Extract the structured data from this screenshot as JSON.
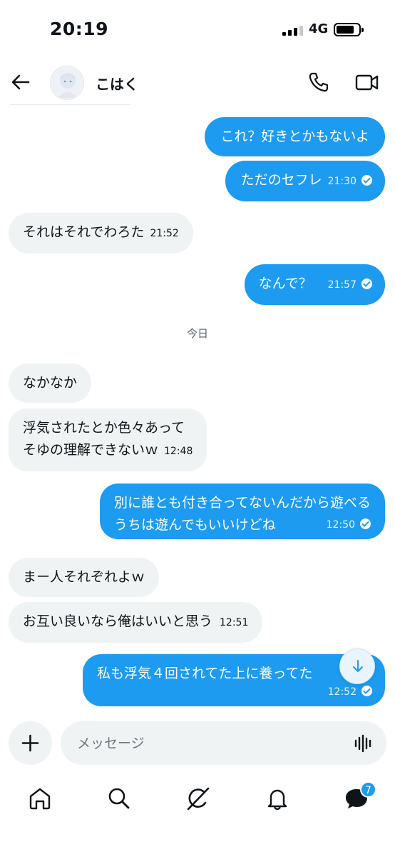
{
  "status_bar": {
    "time": "20:19",
    "network": "4G"
  },
  "header": {
    "contact_name": "こはく"
  },
  "date_separator": "今日",
  "messages": [
    {
      "dir": "out",
      "text": "これ？好きとかもないよ"
    },
    {
      "dir": "out",
      "text": "ただのセフレ",
      "time": "21:30",
      "read": true
    },
    {
      "dir": "in",
      "text": "それはそれでわろた",
      "time": "21:52"
    },
    {
      "dir": "out",
      "text": "なんで？",
      "time": "21:57",
      "read": true
    },
    {
      "dir": "in",
      "text": "なかなか"
    },
    {
      "dir": "in",
      "lines": [
        "浮気されたとか色々あって",
        "そゆの理解できないｗ"
      ],
      "time": "12:48"
    },
    {
      "dir": "out",
      "lines": [
        "別に誰とも付き合ってないんだから遊べる",
        "うちは遊んでもいいけどね"
      ],
      "time": "12:50",
      "read": true
    },
    {
      "dir": "in",
      "text": "まー人それぞれよｗ"
    },
    {
      "dir": "in",
      "text": "お互い良いなら俺はいいと思う",
      "time": "12:51"
    },
    {
      "dir": "out",
      "text": "私も浮気４回されてた上に養ってた",
      "time": "12:52",
      "read": true
    }
  ],
  "composer": {
    "placeholder": "メッセージ"
  },
  "bottom_nav": {
    "messages_badge": "7"
  },
  "icons": [
    "back-arrow-icon",
    "phone-icon",
    "video-icon",
    "plus-icon",
    "voice-wave-icon",
    "home-icon",
    "search-icon",
    "grok-icon",
    "bell-icon",
    "messages-icon",
    "arrow-down-icon",
    "read-check-icon"
  ],
  "colors": {
    "accent": "#1d9bf0",
    "incoming_bubble": "#eff3f4"
  }
}
